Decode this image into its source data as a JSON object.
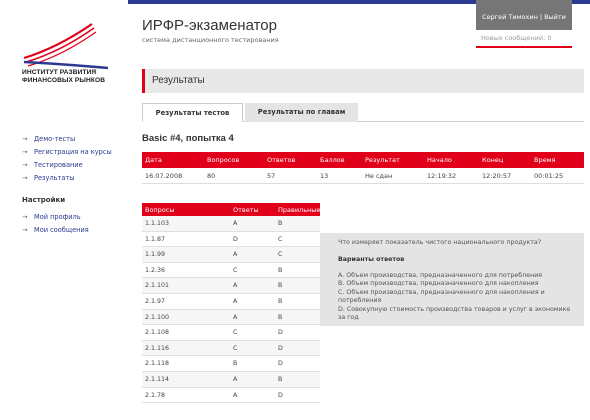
{
  "header": {
    "app_title": "ИРФР-экзаменатор",
    "app_subtitle": "система дистанционного тестирования",
    "user_name": "Сергей Тимохин",
    "separator": "|",
    "logout": "Выйти",
    "new_messages": "Новых сообщений: 0"
  },
  "logo": {
    "line1": "ИНСТИТУТ РАЗВИТИЯ",
    "line2": "ФИНАНСОВЫХ РЫНКОВ"
  },
  "sidebar": {
    "items": [
      {
        "label": "Демо-тесты"
      },
      {
        "label": "Регистрация на курсы"
      },
      {
        "label": "Тестирование"
      },
      {
        "label": "Результаты"
      }
    ],
    "settings_title": "Настройки",
    "settings_items": [
      {
        "label": "Мой профиль"
      },
      {
        "label": "Мои сообщения"
      }
    ]
  },
  "section": {
    "title": "Результаты"
  },
  "tabs": [
    {
      "label": "Результаты тестов"
    },
    {
      "label": "Результаты по главам"
    }
  ],
  "attempt_title": "Basic #4, попытка 4",
  "summary": {
    "headers": [
      "Дата",
      "Вопросов",
      "Ответов",
      "Баллов",
      "Результат",
      "Начало",
      "Конец",
      "Время"
    ],
    "row": [
      "16.07.2008",
      "80",
      "57",
      "13",
      "Не сдан",
      "12:19:32",
      "12:20:57",
      "00:01:25"
    ]
  },
  "answers": {
    "headers": [
      "Вопросы",
      "Ответы",
      "Правильные"
    ],
    "rows": [
      [
        "1.1.103",
        "A",
        "B"
      ],
      [
        "1.1.87",
        "D",
        "C"
      ],
      [
        "1.1.99",
        "A",
        "C"
      ],
      [
        "1.2.36",
        "C",
        "B"
      ],
      [
        "2.1.101",
        "A",
        "B"
      ],
      [
        "2.1.97",
        "A",
        "B"
      ],
      [
        "2.1.100",
        "A",
        "B"
      ],
      [
        "2.1.108",
        "C",
        "D"
      ],
      [
        "2.1.116",
        "C",
        "D"
      ],
      [
        "2.1.118",
        "B",
        "D"
      ],
      [
        "2.1.114",
        "A",
        "B"
      ],
      [
        "2.1.78",
        "A",
        "D"
      ]
    ]
  },
  "question": {
    "text": "Что измеряет показатель чистого национального продукта?",
    "variants_title": "Варианты ответов",
    "options": [
      "A. Объем производства, предназначенного для потребления",
      "B. Объем производства, предназначенного для накопления",
      "C. Объем производства, предназначенного для накопления и потребления",
      "D. Совокупную стоимость производства товаров и услуг в экономике за год"
    ]
  },
  "colors": {
    "accent_red": "#e1001a",
    "brand_blue": "#2b3990",
    "header_gray": "#767676"
  }
}
